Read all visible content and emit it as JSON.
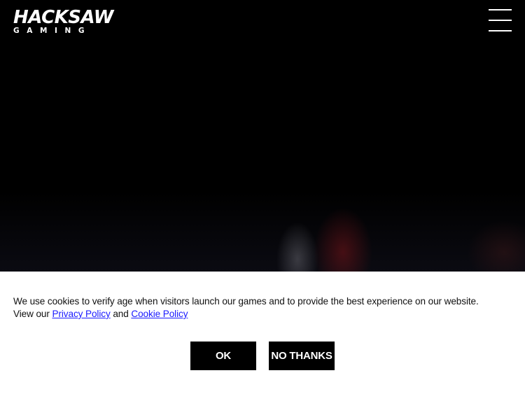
{
  "header": {
    "logo_main": "HACKSAW",
    "logo_sub": "GAMING",
    "menu_icon": "hamburger-menu-icon"
  },
  "cookie_banner": {
    "text_before": "We use cookies to verify age when visitors launch our games and to provide the best experience on our website. View our ",
    "privacy_link": "Privacy Policy",
    "text_between": " and ",
    "cookie_link": "Cookie Policy",
    "ok_label": "OK",
    "no_thanks_label": "NO THANKS"
  },
  "colors": {
    "background": "#000000",
    "banner_background": "#ffffff",
    "link": "#1a1aff",
    "button_background": "#000000",
    "button_text": "#ffffff"
  }
}
